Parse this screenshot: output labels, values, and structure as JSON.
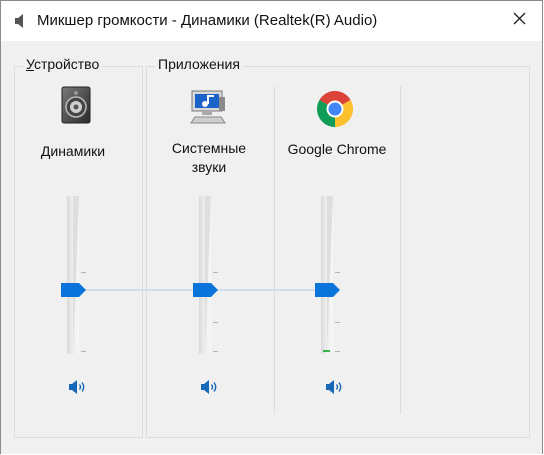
{
  "window": {
    "title": "Микшер громкости - Динамики (Realtek(R) Audio)",
    "close_glyph": "✕"
  },
  "device_group": {
    "label_accesskey": "У",
    "label_rest": "стройство",
    "device_name": "Динамики",
    "icon": "speaker-device-icon",
    "volume": 0.5
  },
  "apps_group": {
    "label": "Приложения",
    "apps": [
      {
        "name_line1": "Системные",
        "name_line2": "звуки",
        "icon": "system-sounds-icon",
        "volume": 0.5
      },
      {
        "name_line1": "Google Chrome",
        "name_line2": "",
        "icon": "chrome-icon",
        "volume": 0.5
      }
    ]
  },
  "colors": {
    "accent": "#0a74da",
    "window_bg": "#f0f0f0",
    "border": "#dcdcdc"
  }
}
